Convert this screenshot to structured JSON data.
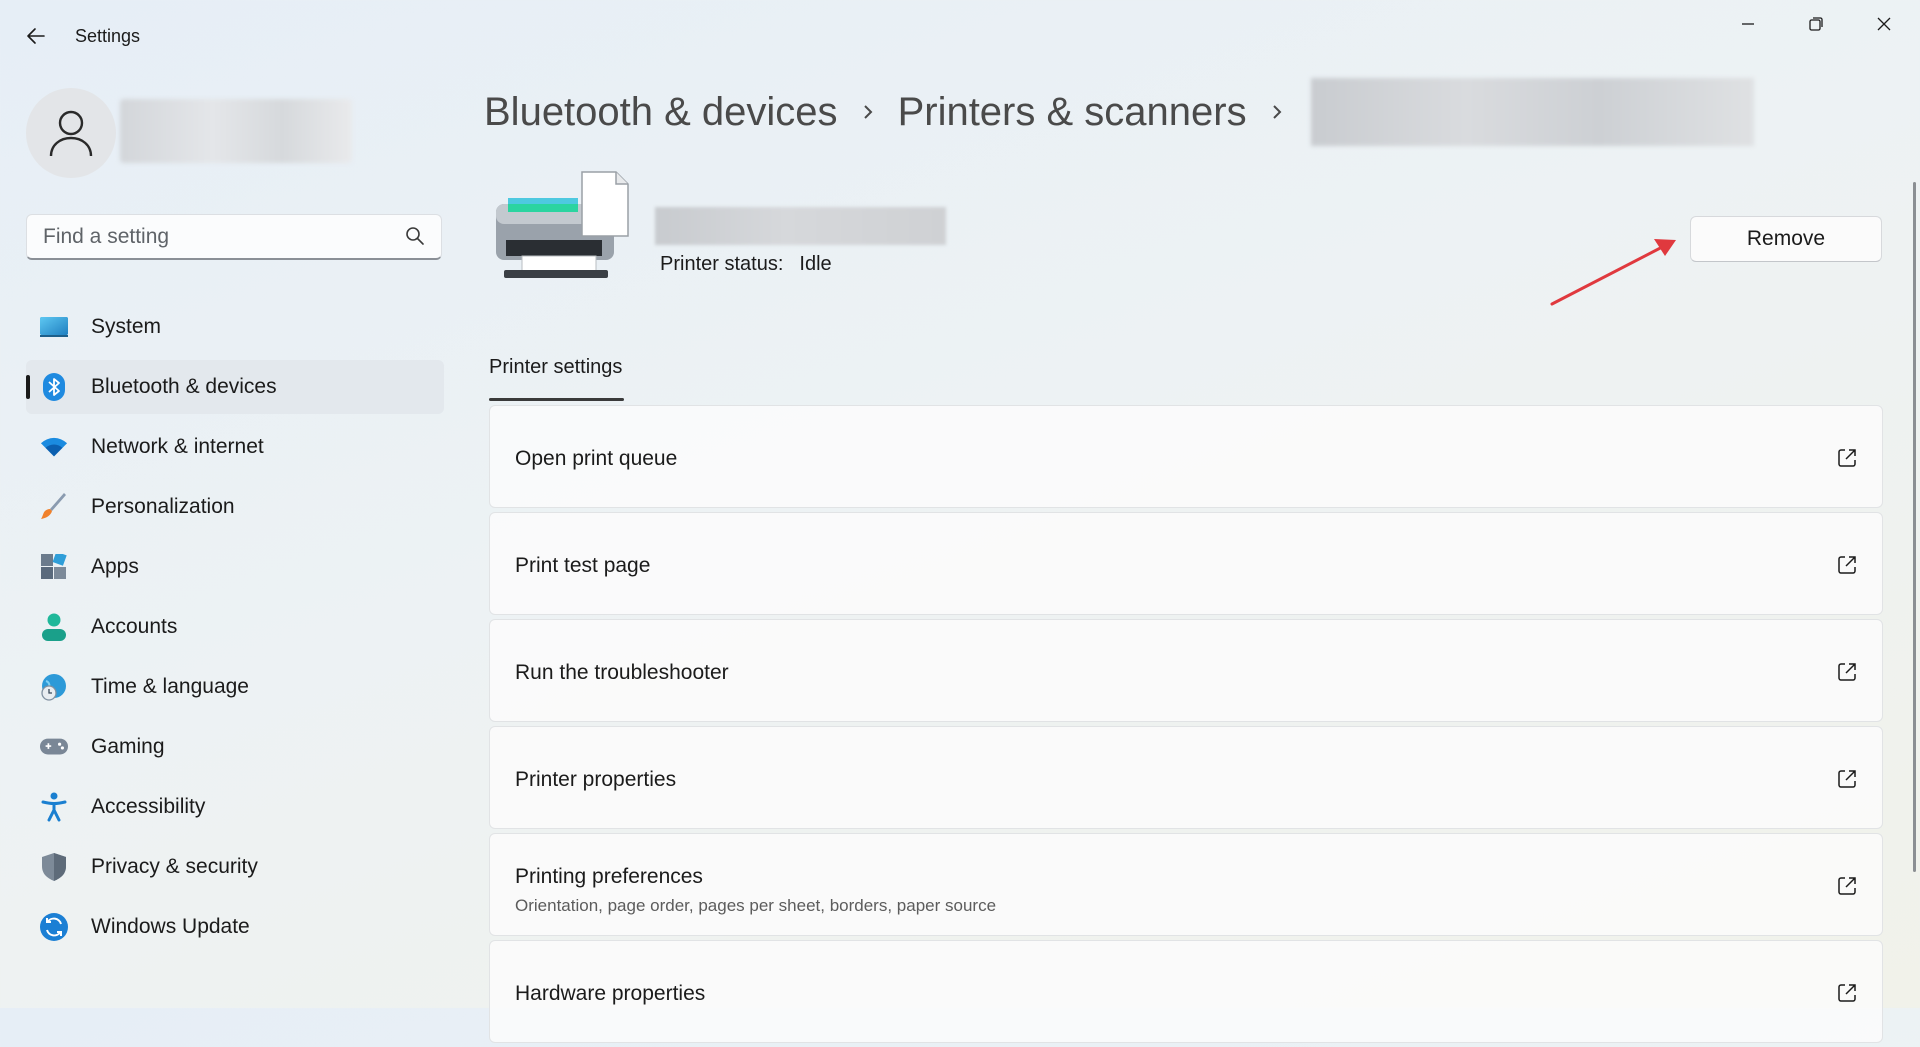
{
  "window": {
    "title": "Settings",
    "controls": {
      "minimize": "minimize",
      "restore": "restore",
      "close": "close"
    }
  },
  "search": {
    "placeholder": "Find a setting"
  },
  "sidebar": {
    "items": [
      {
        "label": "System",
        "icon": "system-icon"
      },
      {
        "label": "Bluetooth & devices",
        "icon": "bluetooth-icon",
        "active": true
      },
      {
        "label": "Network & internet",
        "icon": "wifi-icon"
      },
      {
        "label": "Personalization",
        "icon": "brush-icon"
      },
      {
        "label": "Apps",
        "icon": "apps-icon"
      },
      {
        "label": "Accounts",
        "icon": "accounts-icon"
      },
      {
        "label": "Time & language",
        "icon": "globe-clock-icon"
      },
      {
        "label": "Gaming",
        "icon": "gamepad-icon"
      },
      {
        "label": "Accessibility",
        "icon": "accessibility-icon"
      },
      {
        "label": "Privacy & security",
        "icon": "shield-icon"
      },
      {
        "label": "Windows Update",
        "icon": "update-icon"
      }
    ]
  },
  "breadcrumb": {
    "items": [
      "Bluetooth & devices",
      "Printers & scanners"
    ]
  },
  "printer": {
    "status_label": "Printer status:",
    "status_value": "Idle",
    "remove_label": "Remove"
  },
  "section": {
    "tab_label": "Printer settings"
  },
  "cards": [
    {
      "title": "Open print queue",
      "subtitle": ""
    },
    {
      "title": "Print test page",
      "subtitle": ""
    },
    {
      "title": "Run the troubleshooter",
      "subtitle": ""
    },
    {
      "title": "Printer properties",
      "subtitle": ""
    },
    {
      "title": "Printing preferences",
      "subtitle": "Orientation, page order, pages per sheet, borders, paper source"
    },
    {
      "title": "Hardware properties",
      "subtitle": ""
    }
  ],
  "colors": {
    "accent": "#0067c0",
    "annotation_arrow": "#e0393e"
  }
}
